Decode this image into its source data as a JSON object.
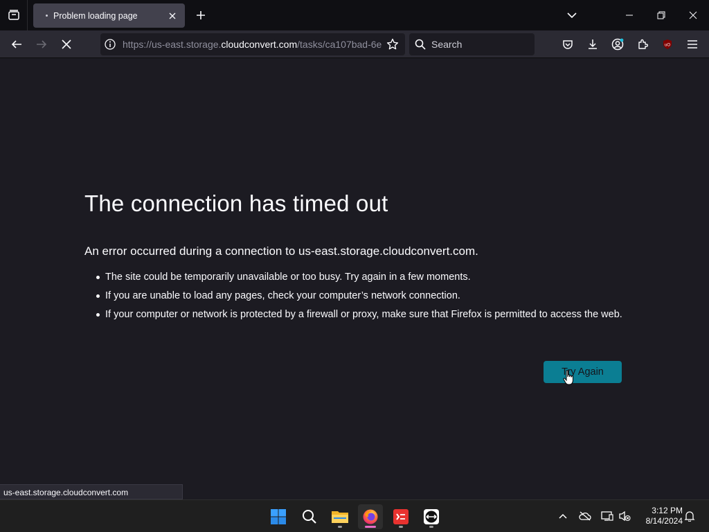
{
  "tab": {
    "title": "Problem loading page"
  },
  "navbar": {
    "url_prefix": "https://us-east.storage.",
    "url_host": "cloudconvert.com",
    "url_suffix": "/tasks/ca107bad-6e",
    "search_placeholder": "Search"
  },
  "error": {
    "title": "The connection has timed out",
    "description": "An error occurred during a connection to us-east.storage.cloudconvert.com.",
    "items": [
      "The site could be temporarily unavailable or too busy. Try again in a few moments.",
      "If you are unable to load any pages, check your computer’s network connection.",
      "If your computer or network is protected by a firewall or proxy, make sure that Firefox is permitted to access the web."
    ],
    "button_label": "Try Again"
  },
  "status": {
    "text": "us-east.storage.cloudconvert.com"
  },
  "taskbar": {
    "time": "3:12 PM",
    "date": "8/14/2024"
  },
  "colors": {
    "accent": "#0b7e93",
    "background": "#1c1b22",
    "toolbar": "#2b2a33"
  }
}
